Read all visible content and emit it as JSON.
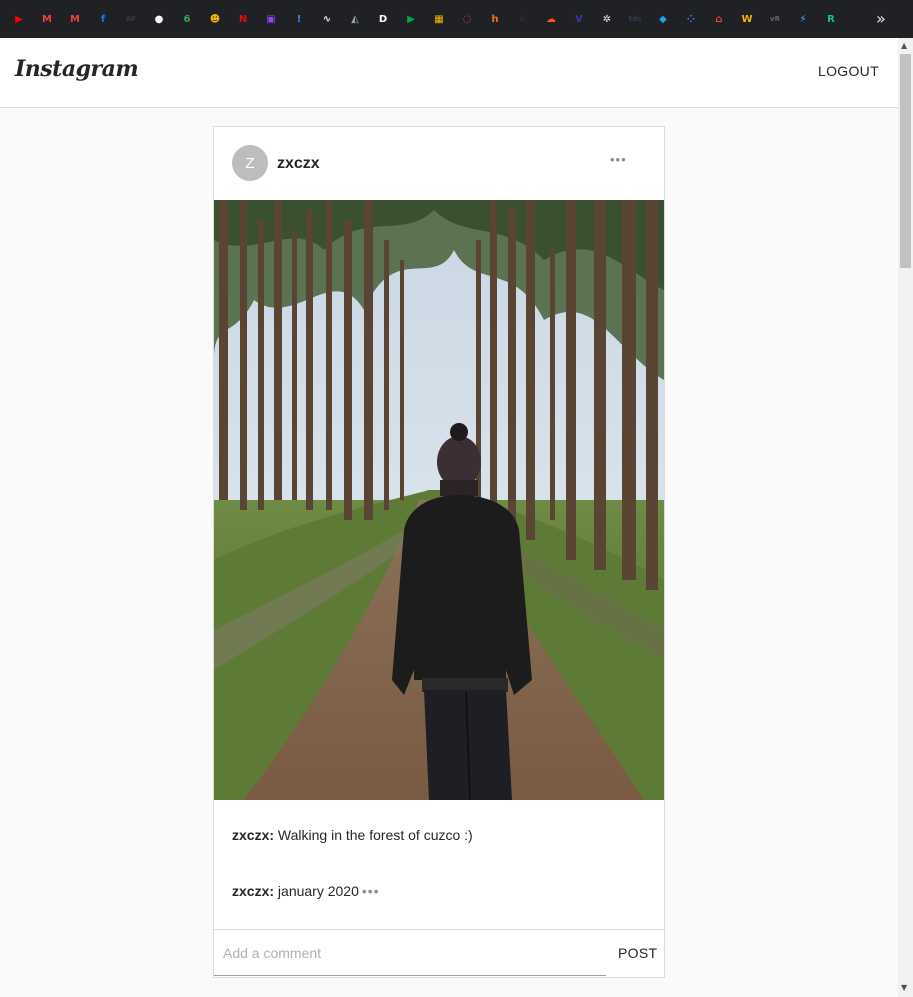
{
  "bookmarks": {
    "icons": [
      {
        "name": "youtube-icon",
        "color": "#ff0000",
        "glyph": "▶"
      },
      {
        "name": "gmail-icon",
        "color": "#ea4335",
        "glyph": "M"
      },
      {
        "name": "gmail-icon",
        "color": "#ea4335",
        "glyph": "M"
      },
      {
        "name": "facebook-icon",
        "color": "#1877f2",
        "glyph": "f"
      },
      {
        "name": "af-icon",
        "color": "#3a3a3a",
        "glyph": "AF"
      },
      {
        "name": "github-icon",
        "color": "#ffffff",
        "glyph": "●"
      },
      {
        "name": "six-icon",
        "color": "#34a853",
        "glyph": "6"
      },
      {
        "name": "bug-icon",
        "color": "#f4b400",
        "glyph": "☻"
      },
      {
        "name": "netflix-icon",
        "color": "#e50914",
        "glyph": "N"
      },
      {
        "name": "twitch-icon",
        "color": "#9146ff",
        "glyph": "▣"
      },
      {
        "name": "exclamation-icon",
        "color": "#4285f4",
        "glyph": "!"
      },
      {
        "name": "waveform-icon",
        "color": "#e8eaed",
        "glyph": "∿"
      },
      {
        "name": "cap-icon",
        "color": "#9aa0a6",
        "glyph": "◭"
      },
      {
        "name": "d-icon",
        "color": "#ffffff",
        "glyph": "D"
      },
      {
        "name": "meet-icon",
        "color": "#00ac47",
        "glyph": "▶"
      },
      {
        "name": "classroom-icon",
        "color": "#fbbc04",
        "glyph": "▦"
      },
      {
        "name": "circle-icon",
        "color": "#ea4335",
        "glyph": "◌"
      },
      {
        "name": "h-icon",
        "color": "#f37021",
        "glyph": "h"
      },
      {
        "name": "k-icon",
        "color": "#2b2b2b",
        "glyph": "k"
      },
      {
        "name": "soundcloud-icon",
        "color": "#ff5500",
        "glyph": "☁"
      },
      {
        "name": "v-icon",
        "color": "#3b3b98",
        "glyph": "V"
      },
      {
        "name": "gear-icon",
        "color": "#e8eaed",
        "glyph": "✲"
      },
      {
        "name": "tds-icon",
        "color": "#2d3e50",
        "glyph": "tds"
      },
      {
        "name": "cube-icon",
        "color": "#1da1f2",
        "glyph": "◆"
      },
      {
        "name": "dots-icon",
        "color": "#4285f4",
        "glyph": "⁘"
      },
      {
        "name": "store-icon",
        "color": "#ea4335",
        "glyph": "⌂"
      },
      {
        "name": "w-icon",
        "color": "#f4b400",
        "glyph": "W"
      },
      {
        "name": "vr-icon",
        "color": "#5f6368",
        "glyph": "vR"
      },
      {
        "name": "bolt-icon",
        "color": "#4ab3f4",
        "glyph": "⚡"
      },
      {
        "name": "r-icon",
        "color": "#1abc9c",
        "glyph": "R"
      }
    ],
    "more": "»"
  },
  "header": {
    "logo": "Instagram",
    "logout_label": "LOGOUT"
  },
  "post": {
    "avatar_letter": "Z",
    "username": "zxczx",
    "more_glyph": "•••",
    "caption": {
      "user": "zxczx:",
      "text": " Walking in the forest of cuzco :)"
    },
    "comments": [
      {
        "user": "zxczx:",
        "text": " january 2020",
        "more": "•••"
      }
    ],
    "comment_placeholder": "Add a comment",
    "post_label": "POST"
  }
}
